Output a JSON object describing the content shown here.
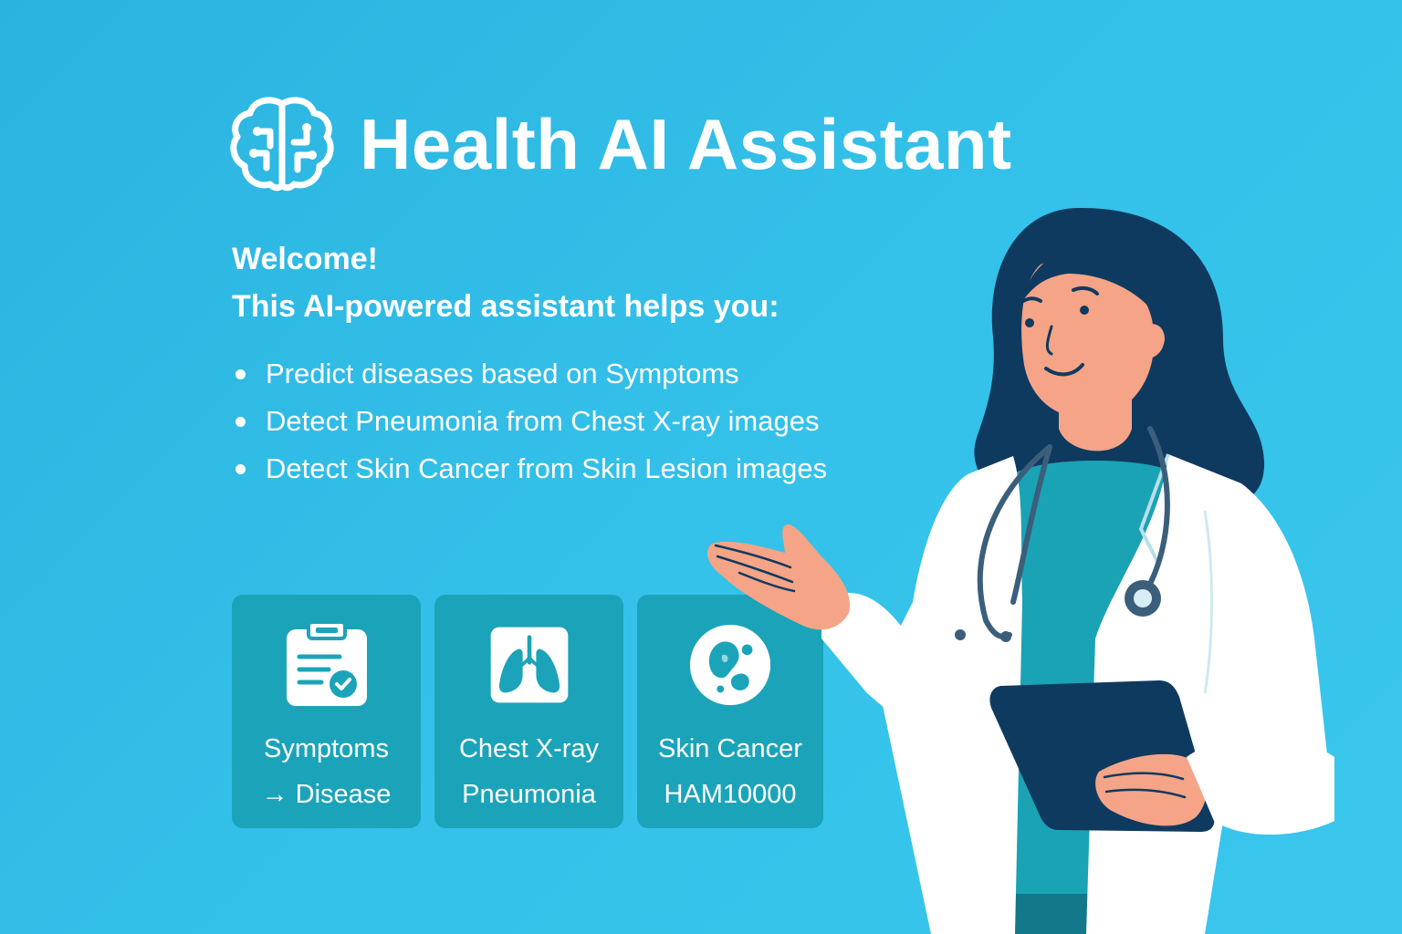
{
  "header": {
    "title": "Health AI Assistant",
    "logo_icon": "brain-circuit-icon"
  },
  "intro": {
    "welcome": "Welcome!",
    "subtitle": "This AI-powered assistant helps you:"
  },
  "features": [
    "Predict diseases based on Symptoms",
    "Detect Pneumonia from Chest X-ray images",
    "Detect Skin Cancer from Skin Lesion images"
  ],
  "cards": [
    {
      "line1": "Symptoms",
      "line2": "→ Disease",
      "icon": "clipboard-check-icon"
    },
    {
      "line1": "Chest X-ray",
      "line2": "Pneumonia",
      "icon": "lungs-icon"
    },
    {
      "line1": "Skin Cancer",
      "line2": "HAM10000",
      "icon": "skin-lesion-icon"
    }
  ],
  "colors": {
    "background": "#2bb3df",
    "card": "#1ba4b9",
    "text": "#ffffff",
    "accent_navy": "#0f3a5f"
  }
}
